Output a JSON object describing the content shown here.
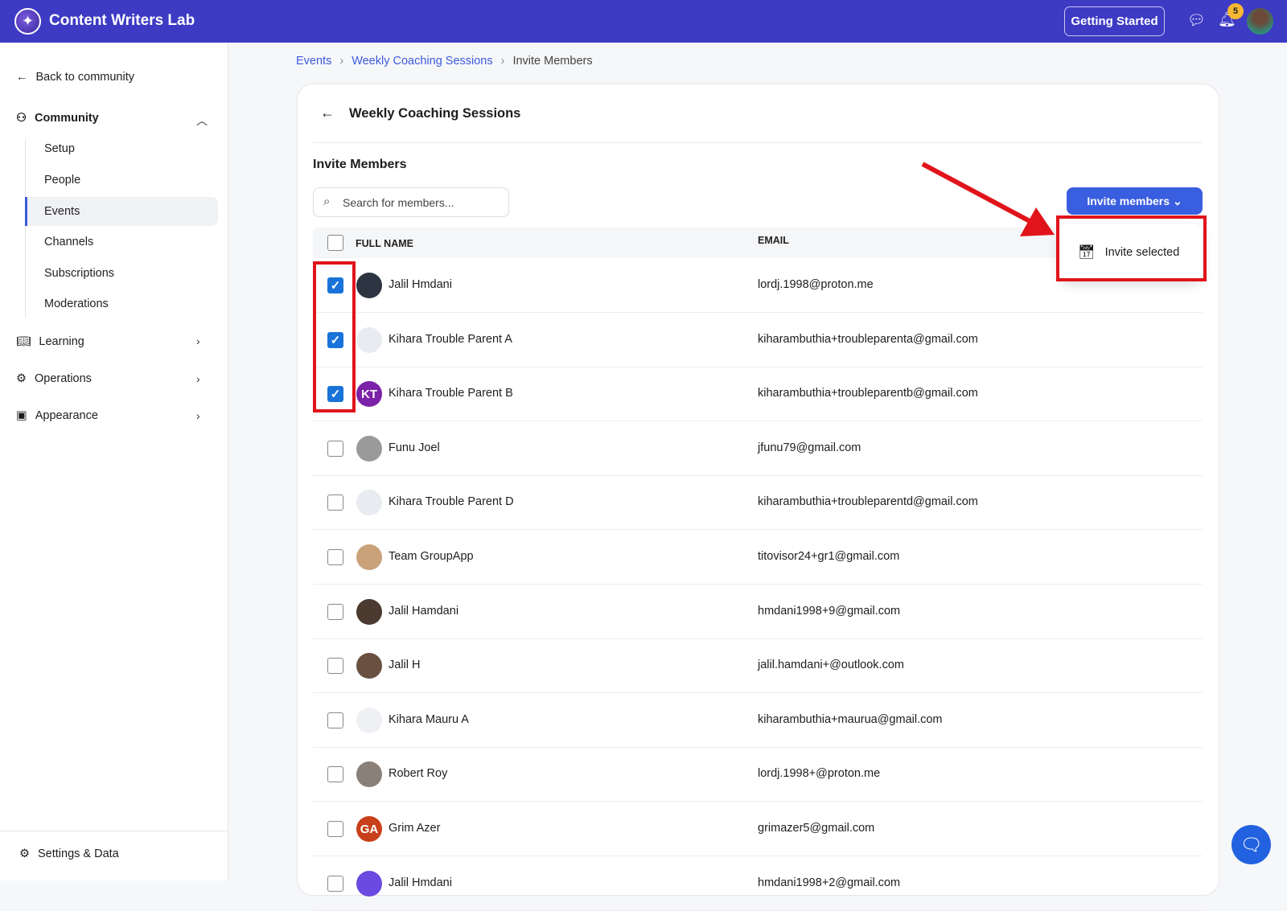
{
  "header": {
    "app_name": "Content Writers Lab",
    "getting_started": "Getting Started",
    "notification_count": "5"
  },
  "sidebar": {
    "back": "Back to community",
    "community": "Community",
    "sub_items": [
      "Setup",
      "People",
      "Events",
      "Channels",
      "Subscriptions",
      "Moderations"
    ],
    "learning": "Learning",
    "operations": "Operations",
    "appearance": "Appearance",
    "settings": "Settings & Data"
  },
  "breadcrumb": [
    "Events",
    "Weekly Coaching Sessions",
    "Invite Members"
  ],
  "card": {
    "title": "Weekly Coaching Sessions",
    "section": "Invite Members",
    "search_placeholder": "Search for members...",
    "invite_button": "Invite members",
    "dropdown_item": "Invite selected"
  },
  "table": {
    "headers": [
      "FULL NAME",
      "EMAIL"
    ],
    "rows": [
      {
        "name": "Jalil Hmdani",
        "email": "lordj.1998@proton.me",
        "checked": true,
        "initials": "",
        "color": "#2b3440"
      },
      {
        "name": "Kihara Trouble Parent A",
        "email": "kiharambuthia+troubleparenta@gmail.com",
        "checked": true,
        "initials": "",
        "color": "#e8ebf0"
      },
      {
        "name": "Kihara Trouble Parent B",
        "email": "kiharambuthia+troubleparentb@gmail.com",
        "checked": true,
        "initials": "KT",
        "color": "#7b22a8"
      },
      {
        "name": "Funu Joel",
        "email": "jfunu79@gmail.com",
        "checked": false,
        "initials": "",
        "color": "#9a9a9a"
      },
      {
        "name": "Kihara Trouble Parent D",
        "email": "kiharambuthia+troubleparentd@gmail.com",
        "checked": false,
        "initials": "",
        "color": "#e8ebf0"
      },
      {
        "name": "Team GroupApp",
        "email": "titovisor24+gr1@gmail.com",
        "checked": false,
        "initials": "",
        "color": "#c9a27a"
      },
      {
        "name": "Jalil Hamdani",
        "email": "hmdani1998+9@gmail.com",
        "checked": false,
        "initials": "",
        "color": "#4a3a30"
      },
      {
        "name": "Jalil H",
        "email": "jalil.hamdani+@outlook.com",
        "checked": false,
        "initials": "",
        "color": "#6a5040"
      },
      {
        "name": "Kihara Mauru A",
        "email": "kiharambuthia+maurua@gmail.com",
        "checked": false,
        "initials": "",
        "color": "#eef0f3"
      },
      {
        "name": "Robert Roy",
        "email": "lordj.1998+@proton.me",
        "checked": false,
        "initials": "",
        "color": "#8a8078"
      },
      {
        "name": "Grim Azer",
        "email": "grimazer5@gmail.com",
        "checked": false,
        "initials": "GA",
        "color": "#c8401a"
      },
      {
        "name": "Jalil Hmdani",
        "email": "hmdani1998+2@gmail.com",
        "checked": false,
        "initials": "",
        "color": "#6a4ae0"
      }
    ]
  }
}
